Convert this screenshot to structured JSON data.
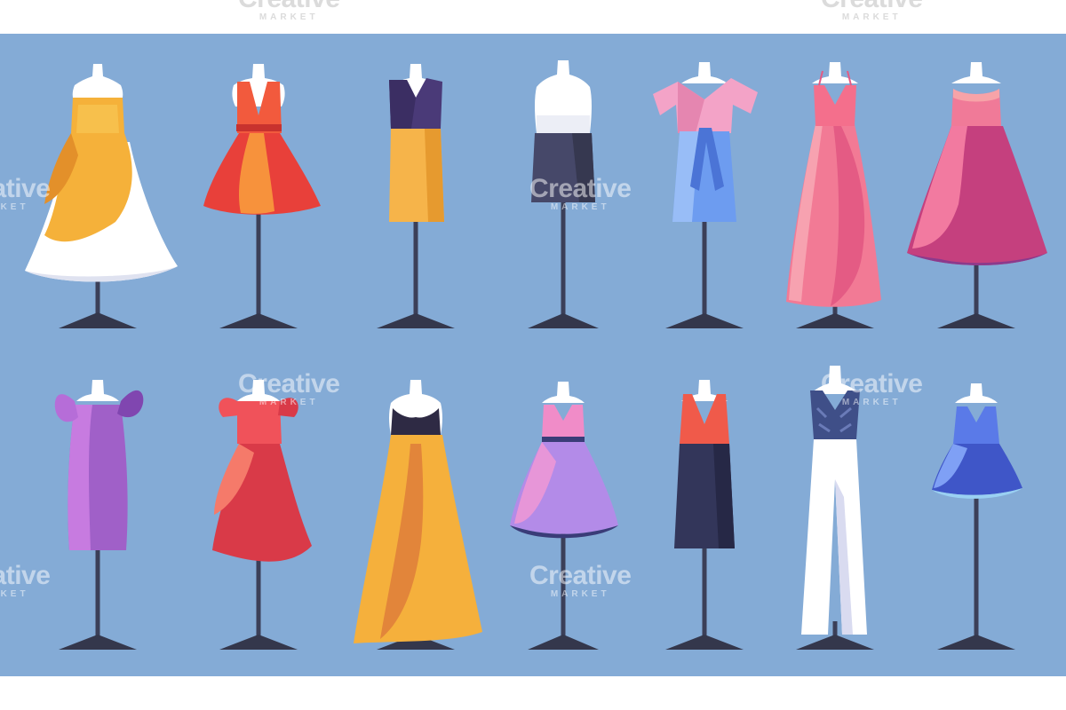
{
  "watermark": {
    "line1": "Creative",
    "line2": "MARKET"
  },
  "colors": {
    "panel": "#84abd6",
    "stand": "#3b3f58",
    "stand_base": "#34374c",
    "mannequin": "#ffffff",
    "mannequin_shade": "#e2e4ee"
  },
  "rows": [
    {
      "dresses": [
        {
          "style": "yellow-white-flared-dress",
          "colors": [
            "#f5b13a",
            "#ffffff",
            "#eef0f8"
          ]
        },
        {
          "style": "red-cocktail-dress",
          "colors": [
            "#f25a3d",
            "#d93a35",
            "#f7923c"
          ]
        },
        {
          "style": "purple-top-yellow-pencil-skirt",
          "colors": [
            "#4a3a78",
            "#f6b44a",
            "#e69a2f"
          ]
        },
        {
          "style": "white-top-navy-skirt",
          "colors": [
            "#ffffff",
            "#464869",
            "#363850"
          ]
        },
        {
          "style": "pink-blouse-blue-skirt",
          "colors": [
            "#f3a3c7",
            "#6d9cf0",
            "#4b74d6"
          ]
        },
        {
          "style": "pink-maxi-gown",
          "colors": [
            "#f27a95",
            "#e45b84",
            "#f7a2b0"
          ]
        },
        {
          "style": "magenta-ball-gown",
          "colors": [
            "#f27aa0",
            "#c5407e",
            "#8c3a8c"
          ]
        }
      ]
    },
    {
      "dresses": [
        {
          "style": "purple-puff-sleeve-dress",
          "colors": [
            "#a060c8",
            "#c77be0",
            "#8046b0"
          ]
        },
        {
          "style": "red-ruffle-dress",
          "colors": [
            "#f0525a",
            "#d93a48",
            "#f57a6a"
          ]
        },
        {
          "style": "black-top-yellow-maxi-skirt",
          "colors": [
            "#2e2a44",
            "#f5b03c",
            "#e2853a"
          ]
        },
        {
          "style": "pink-lilac-skater-dress",
          "colors": [
            "#f08cc8",
            "#b38be8",
            "#3a3c78"
          ]
        },
        {
          "style": "red-top-navy-skirt",
          "colors": [
            "#f05a4a",
            "#33365a",
            "#262846"
          ]
        },
        {
          "style": "lace-top-white-trousers",
          "colors": [
            "#3f4f88",
            "#ffffff",
            "#d9dbf0"
          ]
        },
        {
          "style": "blue-slip-dress",
          "colors": [
            "#5a7ae8",
            "#3f56c8",
            "#7fa0f5"
          ]
        }
      ]
    }
  ]
}
